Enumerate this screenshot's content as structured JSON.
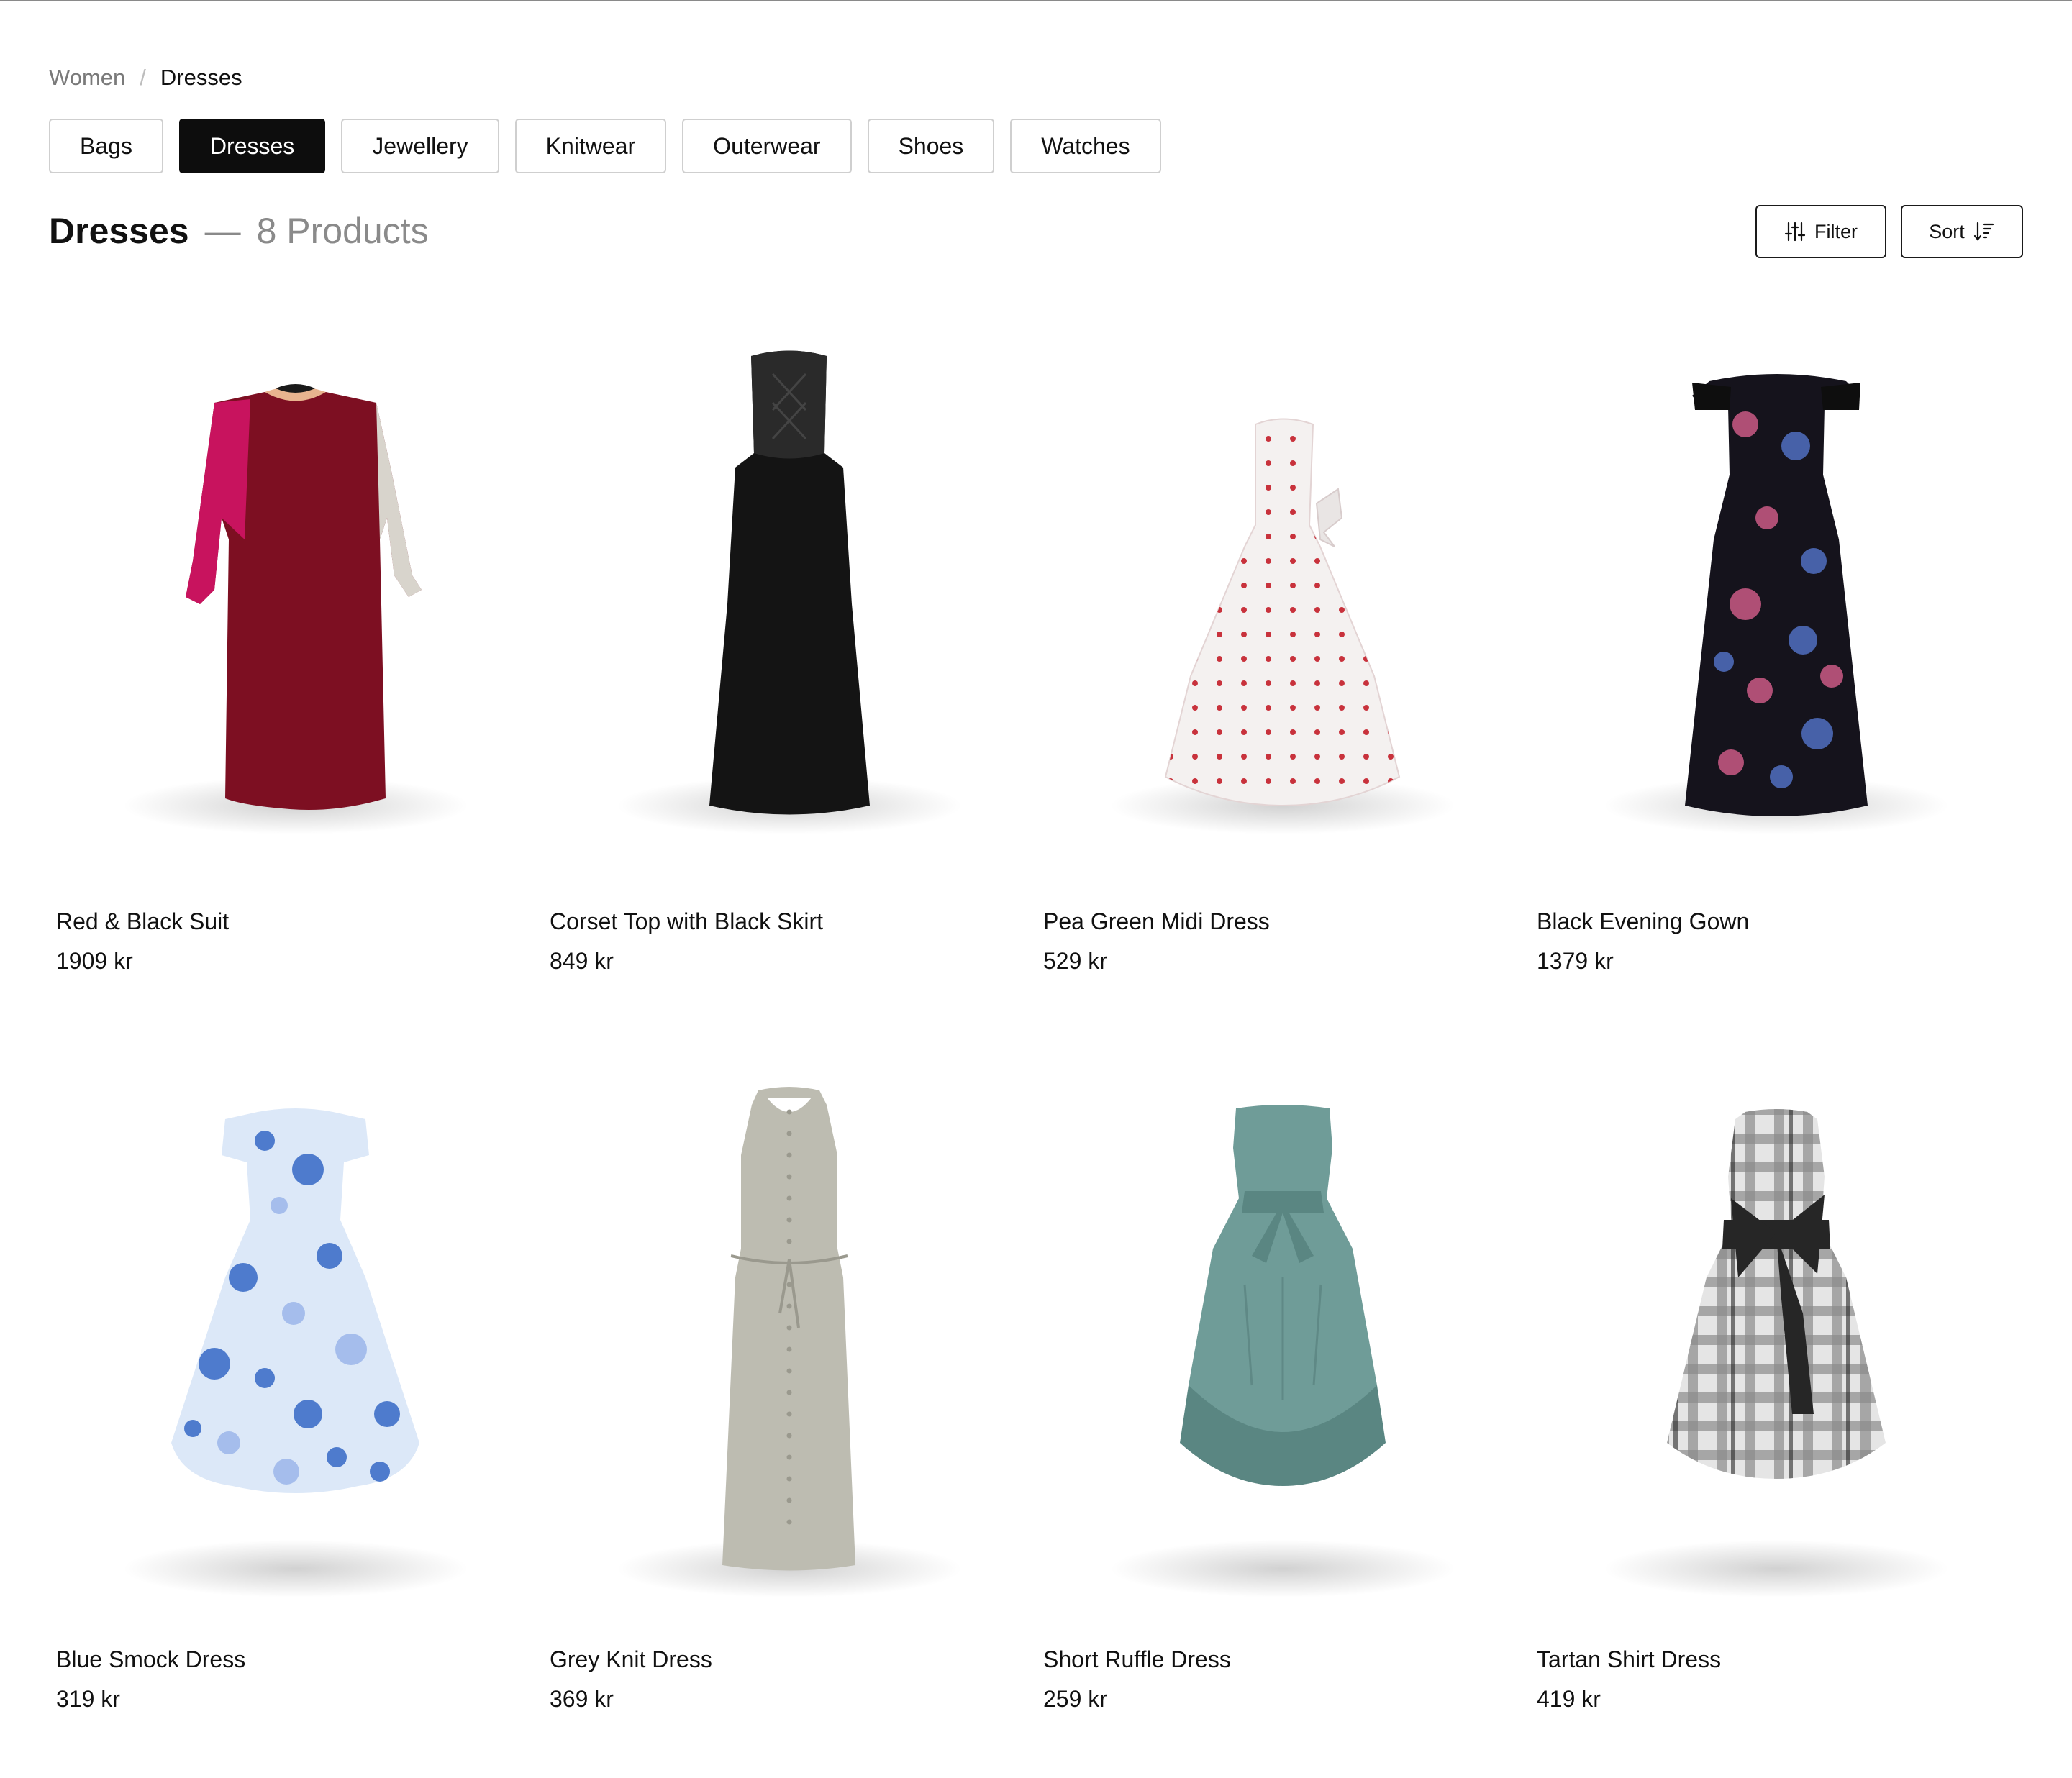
{
  "breadcrumb": {
    "parent": "Women",
    "separator": "/",
    "current": "Dresses"
  },
  "categories": [
    {
      "label": "Bags",
      "active": false
    },
    {
      "label": "Dresses",
      "active": true
    },
    {
      "label": "Jewellery",
      "active": false
    },
    {
      "label": "Knitwear",
      "active": false
    },
    {
      "label": "Outerwear",
      "active": false
    },
    {
      "label": "Shoes",
      "active": false
    },
    {
      "label": "Watches",
      "active": false
    }
  ],
  "heading": {
    "title": "Dresses",
    "dash": "—",
    "count": "8 Products"
  },
  "actions": {
    "filter_label": "Filter",
    "filter_icon": "sliders-icon",
    "sort_label": "Sort",
    "sort_icon": "sort-icon"
  },
  "products": [
    {
      "name": "Red & Black Suit",
      "price": "1909 kr",
      "image": "burgundy long-sleeve dress with pink and grey sleeves",
      "colors": {
        "body": "#7d0f22",
        "accent": "#c8135e",
        "accent2": "#d8d4cc"
      }
    },
    {
      "name": "Corset Top with Black Skirt",
      "price": "849 kr",
      "image": "black strapless corset gown",
      "colors": {
        "body": "#141414",
        "accent": "#2a2a2a"
      }
    },
    {
      "name": "Pea Green Midi Dress",
      "price": "529 kr",
      "image": "white strapless dress with red polka dots",
      "colors": {
        "body": "#f4f1f0",
        "accent": "#c8323c"
      }
    },
    {
      "name": "Black Evening Gown",
      "price": "1379 kr",
      "image": "black off-shoulder gown with floral print",
      "colors": {
        "body": "#15131c",
        "accent": "#c0567f",
        "accent2": "#4d6ab8"
      }
    },
    {
      "name": "Blue Smock Dress",
      "price": "319 kr",
      "image": "light blue dress with blue circle print",
      "colors": {
        "body": "#dce8f8",
        "accent": "#3e6fc8",
        "accent2": "#9fb8ea"
      }
    },
    {
      "name": "Grey Knit Dress",
      "price": "369 kr",
      "image": "grey sleeveless button dress with tie belt",
      "colors": {
        "body": "#bdbcb1",
        "accent": "#9a998e"
      }
    },
    {
      "name": "Short Ruffle Dress",
      "price": "259 kr",
      "image": "teal strapless ruffle dress with bow",
      "colors": {
        "body": "#6f9c98",
        "accent": "#5a8682"
      }
    },
    {
      "name": "Tartan Shirt Dress",
      "price": "419 kr",
      "image": "black and white plaid dress with black bow",
      "colors": {
        "body": "#e5e5e5",
        "accent": "#262626",
        "accent2": "#8c8c8c"
      }
    }
  ]
}
